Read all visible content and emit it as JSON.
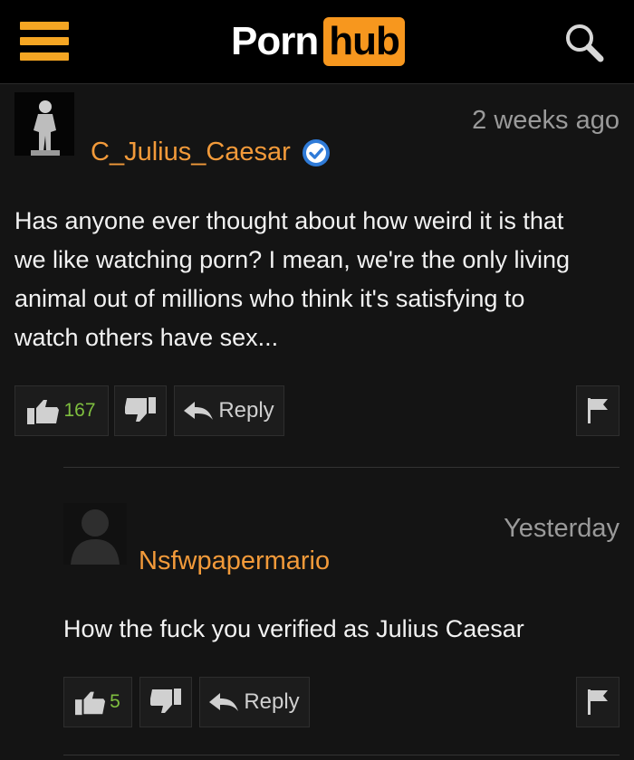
{
  "header": {
    "logo_left": "Porn",
    "logo_right": "hub",
    "brand_color": "#f7971e",
    "menu_icon": "hamburger-menu-icon",
    "search_icon": "search-icon"
  },
  "comments": [
    {
      "username": "C_Julius_Caesar",
      "verified": true,
      "timestamp": "2 weeks ago",
      "text": "Has anyone ever thought about how weird it is that we like watching porn? I mean, we're the only living animal out of millions who think it's satisfying to watch others have sex...",
      "likes": "167",
      "reply_label": "Reply"
    },
    {
      "username": "Nsfwpapermario",
      "verified": false,
      "timestamp": "Yesterday",
      "text": "How the fuck you verified as Julius Caesar",
      "likes": "5",
      "reply_label": "Reply"
    }
  ]
}
